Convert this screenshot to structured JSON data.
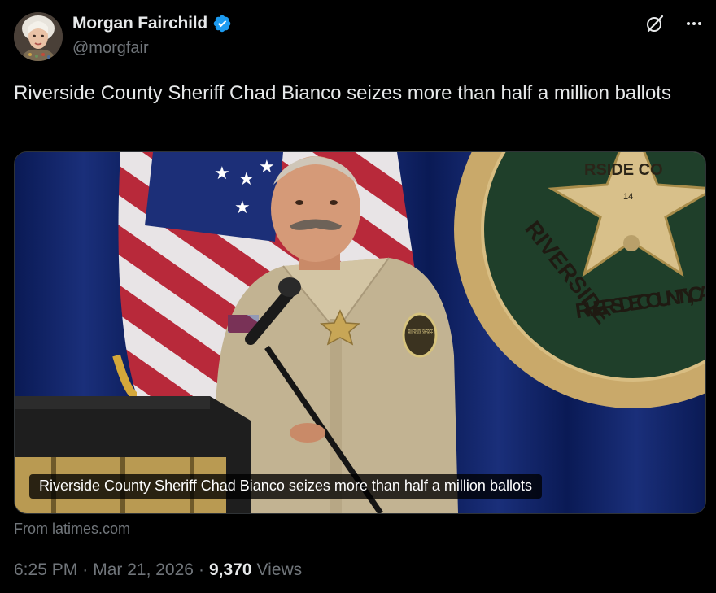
{
  "author": {
    "name": "Morgan Fairchild",
    "handle": "@morgfair",
    "verified": true
  },
  "icons": {
    "verified": "verified-badge-icon",
    "grok": "grok-icon",
    "more": "more-options-icon"
  },
  "tweet": {
    "text": "Riverside County Sheriff Chad Bianco seizes more than half a million ballots"
  },
  "card": {
    "caption": "Riverside County Sheriff Chad Bianco seizes more than half a million ballots",
    "source": "From latimes.com",
    "seal_text": "RIVERSIDE COUNTY, CA",
    "badge_text": "RSIDE CO",
    "badge_number": "14",
    "patch_text": "RIVERSIDE SHERIFF"
  },
  "meta": {
    "time": "6:25 PM",
    "separator": "·",
    "date": "Mar 21, 2026",
    "views_count": "9,370",
    "views_label": "Views"
  },
  "colors": {
    "background": "#000000",
    "text": "#e7e9ea",
    "muted": "#71767b",
    "verified": "#1d9bf0",
    "border": "#2f3336"
  }
}
